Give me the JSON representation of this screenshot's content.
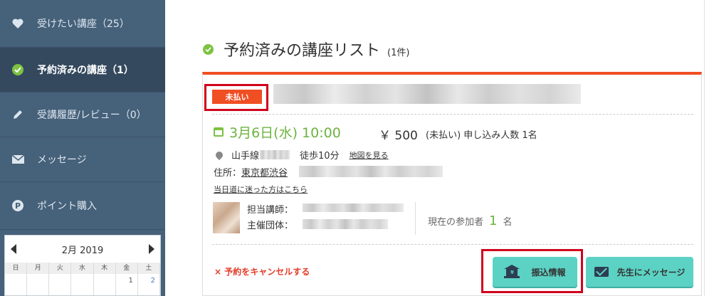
{
  "sidebar": {
    "items": [
      {
        "icon": "heart-icon",
        "label": "受けたい講座（25）"
      },
      {
        "icon": "check-circle-icon",
        "label": "予約済みの講座（1）"
      },
      {
        "icon": "pencil-icon",
        "label": "受講履歴/レビュー（0）"
      },
      {
        "icon": "envelope-icon",
        "label": "メッセージ"
      },
      {
        "icon": "point-coin-icon",
        "label": "ポイント購入"
      }
    ]
  },
  "calendar": {
    "month_label": "2月 2019",
    "weekdays": [
      "日",
      "月",
      "火",
      "水",
      "木",
      "金",
      "土"
    ],
    "first_row": [
      "",
      "",
      "",
      "",
      "",
      "1",
      "2"
    ]
  },
  "page": {
    "title": "予約済みの講座リスト",
    "count": "(1件)"
  },
  "lesson": {
    "status_badge": "未払い",
    "date": "3月6日(水) 10:00",
    "price": "￥ 500",
    "price_note": "(未払い)  申し込み人数 1名",
    "line": "山手線",
    "walk": "徒歩10分",
    "map_link": "地図を見る",
    "address_label": "住所：",
    "address": "東京都渋谷",
    "lost_link": "当日道に迷った方はこちら",
    "instructor_label": "担当講師：",
    "organizer_label": "主催団体：",
    "participants_label": "現在の参加者",
    "participants_count": "1",
    "participants_unit": "名",
    "cancel_link": "× 予約をキャンセルする",
    "transfer_button": "振込情報",
    "message_button": "先生にメッセージ"
  },
  "colors": {
    "sidebar": "#46617a",
    "sidebar_active": "#34495e",
    "accent_green": "#6cb33e",
    "card_top": "#f04e23",
    "button": "#5cd2c4",
    "highlight": "#d0021b"
  }
}
